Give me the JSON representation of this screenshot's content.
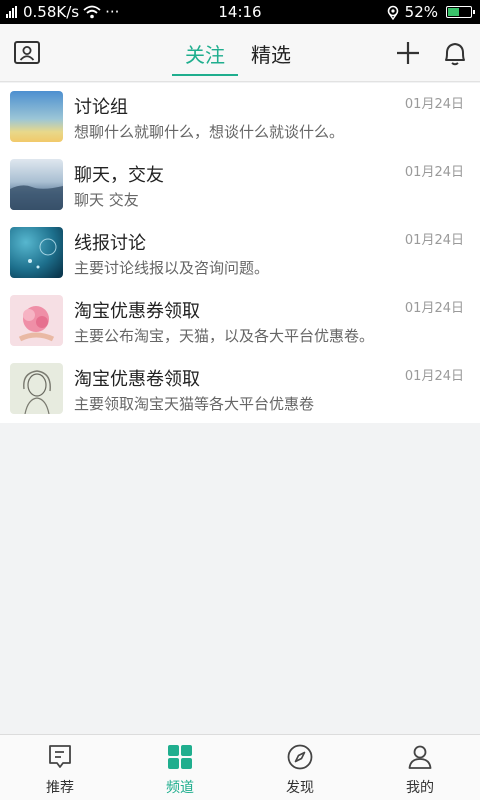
{
  "status_bar": {
    "speed": "0.58K/s",
    "dots": "···",
    "time": "14:16",
    "battery": "52%",
    "battery_level": 0.52
  },
  "header": {
    "tabs": [
      {
        "label": "关注",
        "active": true
      },
      {
        "label": "精选",
        "active": false
      }
    ],
    "icons": [
      "profile-card-icon",
      "plus-icon",
      "bell-icon"
    ]
  },
  "channels": [
    {
      "title": "讨论组",
      "desc": "想聊什么就聊什么，想谈什么就谈什么。",
      "date": "01月24日",
      "thumb": "sunset-sky"
    },
    {
      "title": "聊天，交友",
      "desc": "聊天 交友",
      "date": "01月24日",
      "thumb": "sea-cliff"
    },
    {
      "title": "线报讨论",
      "desc": "主要讨论线报以及咨询问题。",
      "date": "01月24日",
      "thumb": "blue-dandelion"
    },
    {
      "title": "淘宝优惠券领取",
      "desc": "主要公布淘宝，天猫，以及各大平台优惠卷。",
      "date": "01月24日",
      "thumb": "pink-flowers"
    },
    {
      "title": "淘宝优惠卷领取",
      "desc": "主要领取淘宝天猫等各大平台优惠卷",
      "date": "01月24日",
      "thumb": "girl-sketch"
    }
  ],
  "bottom_nav": [
    {
      "label": "推荐",
      "icon": "recommend-icon",
      "active": false
    },
    {
      "label": "频道",
      "icon": "channels-grid-icon",
      "active": true
    },
    {
      "label": "发现",
      "icon": "compass-icon",
      "active": false
    },
    {
      "label": "我的",
      "icon": "user-icon",
      "active": false
    }
  ],
  "colors": {
    "accent": "#1fae8e",
    "background": "#f2f3f4"
  }
}
